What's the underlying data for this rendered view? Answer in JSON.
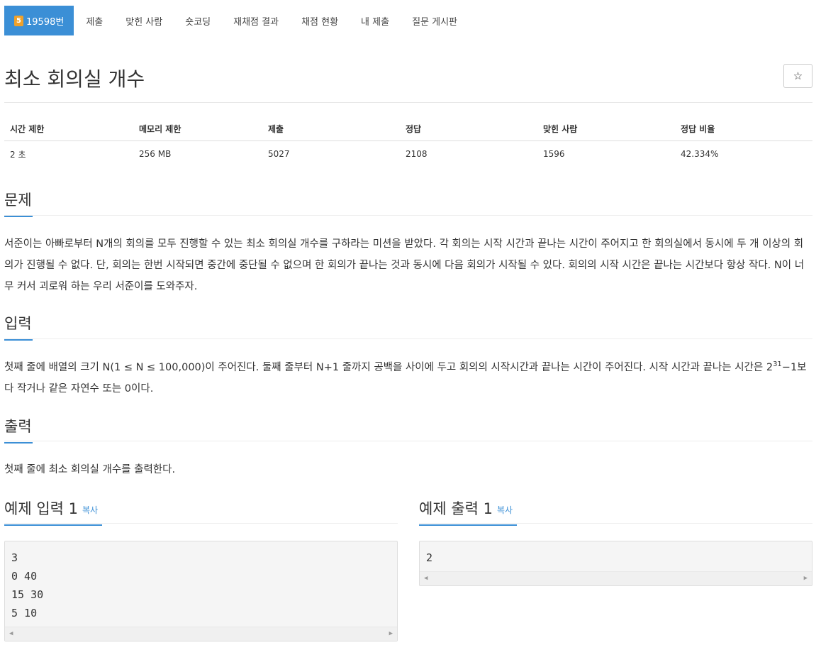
{
  "nav": {
    "tier": "5",
    "problem_id": "19598번",
    "items": [
      "제출",
      "맞힌 사람",
      "숏코딩",
      "재채점 결과",
      "채점 현황",
      "내 제출",
      "질문 게시판"
    ]
  },
  "problem": {
    "title": "최소 회의실 개수",
    "star_icon": "☆"
  },
  "info": {
    "headers": [
      "시간 제한",
      "메모리 제한",
      "제출",
      "정답",
      "맞힌 사람",
      "정답 비율"
    ],
    "values": [
      "2 초",
      "256 MB",
      "5027",
      "2108",
      "1596",
      "42.334%"
    ]
  },
  "sections": {
    "problem_head": "문제",
    "problem_text": "서준이는 아빠로부터 N개의 회의를 모두 진행할 수 있는 최소 회의실 개수를 구하라는 미션을 받았다. 각 회의는 시작 시간과 끝나는 시간이 주어지고 한 회의실에서 동시에 두 개 이상의 회의가 진행될 수 없다. 단, 회의는 한번 시작되면 중간에 중단될 수 없으며 한 회의가 끝나는 것과 동시에 다음 회의가 시작될 수 있다. 회의의 시작 시간은 끝나는 시간보다 항상 작다. N이 너무 커서 괴로워 하는 우리 서준이를 도와주자.",
    "input_head": "입력",
    "input_text_1": "첫째 줄에 배열의 크기 N(1 ≤ N ≤ 100,000)이 주어진다. 둘째 줄부터 N+1 줄까지 공백을 사이에 두고 회의의 시작시간과 끝나는 시간이 주어진다. 시작 시간과 끝나는 시간은 ",
    "input_text_base": "2",
    "input_text_sup": "31",
    "input_text_2": "−1보다 작거나 같은 자연수 또는 0이다.",
    "output_head": "출력",
    "output_text": "첫째 줄에 최소 회의실 개수를 출력한다."
  },
  "samples": {
    "input_label": "예제 입력 1",
    "output_label": "예제 출력 1",
    "copy_label": "복사",
    "input_lines": [
      "3",
      "0 40",
      "15 30",
      "5 10"
    ],
    "output_lines": [
      "2"
    ]
  }
}
